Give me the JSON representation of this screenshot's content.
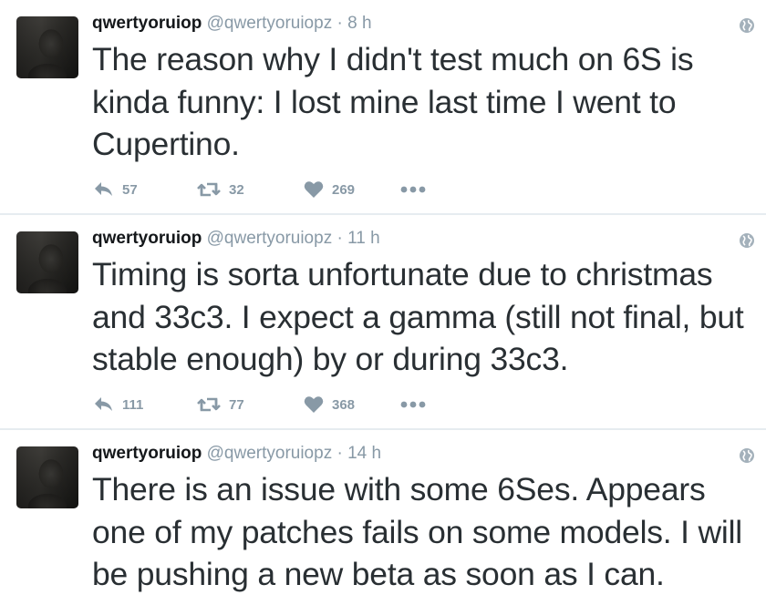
{
  "colors": {
    "muted": "#8899a6",
    "name": "#14171a",
    "text": "#292f33",
    "divider": "#e6ecf0"
  },
  "tweets": [
    {
      "name": "qwertyoruiop",
      "handle": "@qwertyoruiopz",
      "separator": "·",
      "time": "8 h",
      "text": "The reason why I didn't test much on 6S is kinda funny: I lost mine last time I went to Cupertino.",
      "replies": "57",
      "retweets": "32",
      "likes": "269"
    },
    {
      "name": "qwertyoruiop",
      "handle": "@qwertyoruiopz",
      "separator": "·",
      "time": "11 h",
      "text": "Timing is sorta unfortunate due to christmas and 33c3. I expect a gamma (still not final, but stable enough) by or during 33c3.",
      "replies": "111",
      "retweets": "77",
      "likes": "368"
    },
    {
      "name": "qwertyoruiop",
      "handle": "@qwertyoruiopz",
      "separator": "·",
      "time": "14 h",
      "text": "There is an issue with some 6Ses. Appears one of my patches fails on some models. I will be pushing a new beta as soon as I can."
    }
  ],
  "icons": {
    "reply": "reply-icon",
    "retweet": "retweet-icon",
    "like": "heart-icon",
    "more": "more-icon",
    "globe": "globe-icon",
    "avatar": "avatar"
  }
}
